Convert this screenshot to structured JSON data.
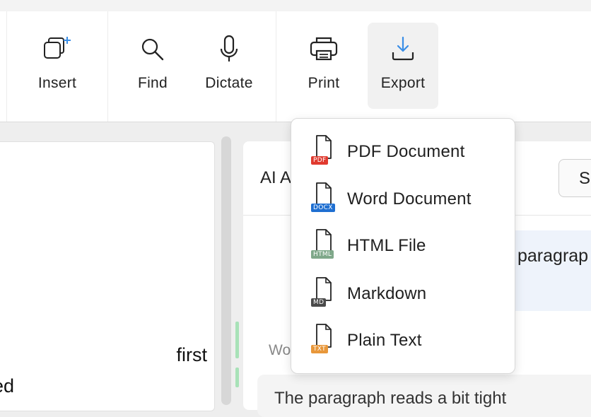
{
  "toolbar": {
    "buttons": [
      {
        "label": "Insert",
        "icon": "insert-icon"
      },
      {
        "label": "Find",
        "icon": "search-icon"
      },
      {
        "label": "Dictate",
        "icon": "microphone-icon"
      },
      {
        "label": "Print",
        "icon": "printer-icon"
      },
      {
        "label": "Export",
        "icon": "download-icon"
      }
    ],
    "accent_color": "#3a8ee6"
  },
  "document": {
    "visible_lines": [
      "first",
      "ed"
    ]
  },
  "ai_panel": {
    "title_fragment": "AI A",
    "select_fragment": "Se",
    "bubble_fragment": "paragrap",
    "section_fragment": "Wo",
    "card_fragment": "The paragraph reads a bit tight"
  },
  "export_menu": {
    "items": [
      {
        "label": "PDF Document",
        "tag": "PDF",
        "tag_color": "#e03a2f"
      },
      {
        "label": "Word Document",
        "tag": "DOCX",
        "tag_color": "#1f6fd1"
      },
      {
        "label": "HTML File",
        "tag": "HTML",
        "tag_color": "#7fa88a"
      },
      {
        "label": "Markdown",
        "tag": "MD",
        "tag_color": "#4a4a4a"
      },
      {
        "label": "Plain Text",
        "tag": "TXT",
        "tag_color": "#e8973a"
      }
    ]
  }
}
